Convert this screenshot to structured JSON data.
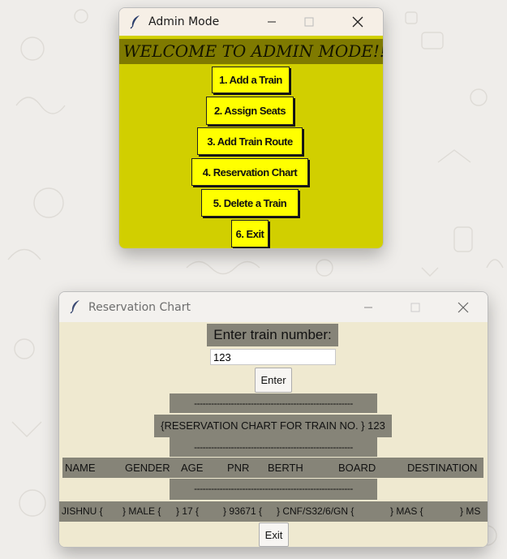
{
  "background": {
    "color": "#efedea"
  },
  "admin_window": {
    "title": "Admin Mode",
    "welcome_text": "WELCOME TO ADMIN MODE!!",
    "buttons": [
      {
        "label": "1. Add a Train"
      },
      {
        "label": "2. Assign Seats"
      },
      {
        "label": "3. Add Train Route"
      },
      {
        "label": "4. Reservation Chart"
      },
      {
        "label": "5. Delete a Train"
      },
      {
        "label": "6. Exit"
      }
    ],
    "colors": {
      "client": "#d1cf00",
      "banner": "#7f7a00",
      "button": "#ffff00"
    }
  },
  "reservation_window": {
    "title": "Reservation Chart",
    "prompt_label": "Enter train number:",
    "train_number_value": "123",
    "enter_button": "Enter",
    "separator": "--------------------------------------------------------",
    "chart_title": "{RESERVATION CHART FOR TRAIN NO. } 123",
    "columns": [
      "NAME",
      "GENDER",
      "AGE",
      "PNR",
      "BERTH",
      "BOARD",
      "DESTINATION"
    ],
    "rows": [
      [
        "JISHNU {",
        "} MALE {",
        "} 17 {",
        "} 93671 {",
        "} CNF/S32/6/GN {",
        "} MAS {",
        "} MS"
      ]
    ],
    "exit_button": "Exit",
    "colors": {
      "client": "#efe9d0",
      "label_bg": "#868478"
    }
  }
}
